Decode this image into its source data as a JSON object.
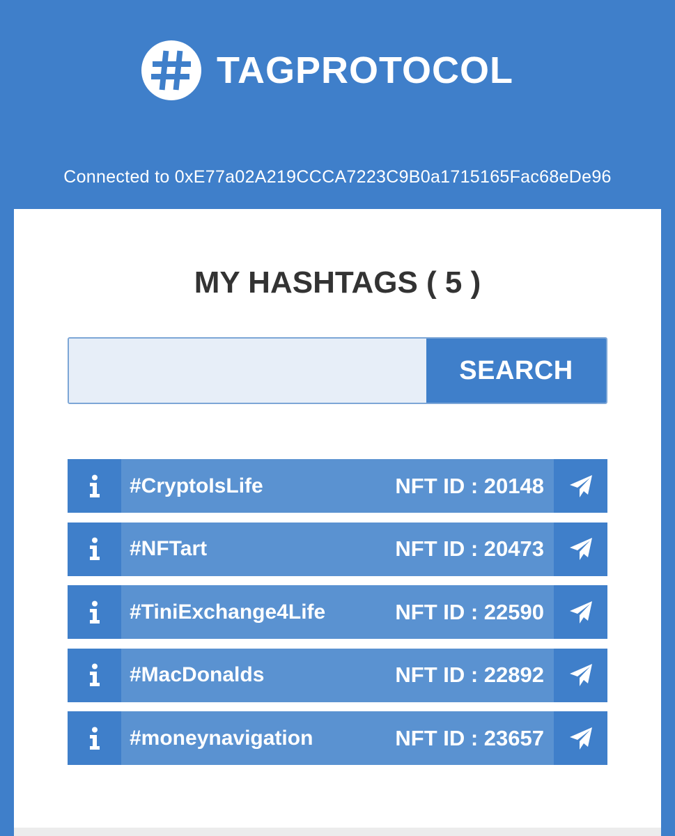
{
  "header": {
    "logo_icon": "hash-icon",
    "brand_name": "TAGPROTOCOL",
    "connection_text": "Connected to 0xE77a02A219CCCA7223C9B0a1715165Fac68eDe96"
  },
  "main": {
    "title": "MY HASHTAGS ( 5 )",
    "search": {
      "value": "",
      "placeholder": "",
      "button_label": "SEARCH"
    },
    "hashtags": [
      {
        "name": "#CryptoIsLife",
        "nft_id": "NFT ID : 20148",
        "info_icon": "info-icon",
        "action_icon": "paper-plane-icon"
      },
      {
        "name": "#NFTart",
        "nft_id": "NFT ID : 20473",
        "info_icon": "info-icon",
        "action_icon": "paper-plane-icon"
      },
      {
        "name": "#TiniExchange4Life",
        "nft_id": "NFT ID : 22590",
        "info_icon": "info-icon",
        "action_icon": "paper-plane-icon"
      },
      {
        "name": "#MacDonalds",
        "nft_id": "NFT ID : 22892",
        "info_icon": "info-icon",
        "action_icon": "paper-plane-icon"
      },
      {
        "name": "#moneynavigation",
        "nft_id": "NFT ID : 23657",
        "info_icon": "info-icon",
        "action_icon": "paper-plane-icon"
      }
    ]
  },
  "colors": {
    "primary": "#3f7fca",
    "row_background": "#5a92d1",
    "search_field": "#e7eef8",
    "title_text": "#333333",
    "panel": "#ffffff"
  }
}
